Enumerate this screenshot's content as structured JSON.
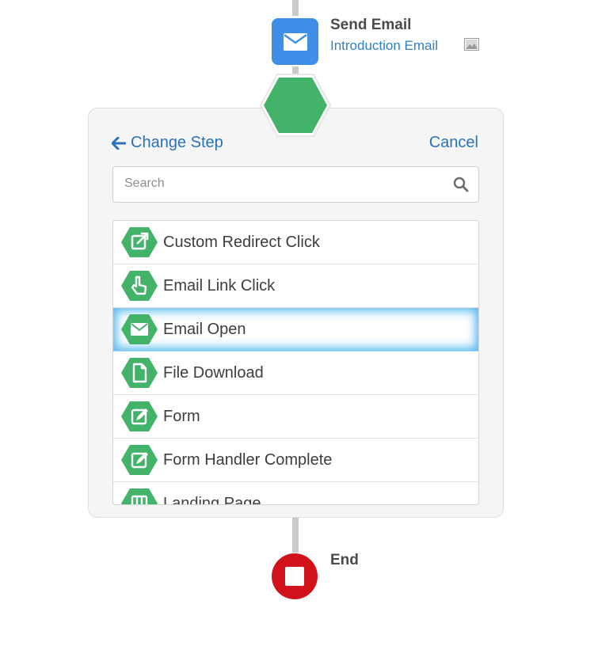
{
  "send_email": {
    "title": "Send Email",
    "subtitle": "Introduction Email",
    "icon": "envelope-icon",
    "subtitle_icon": "image-icon"
  },
  "panel": {
    "change_step_label": "Change Step",
    "cancel_label": "Cancel",
    "search": {
      "placeholder": "Search",
      "value": ""
    },
    "selected_index": 2,
    "items": [
      {
        "label": "Custom Redirect Click",
        "icon": "external-link-icon"
      },
      {
        "label": "Email Link Click",
        "icon": "pointer-hand-icon"
      },
      {
        "label": "Email Open",
        "icon": "envelope-icon"
      },
      {
        "label": "File Download",
        "icon": "file-icon"
      },
      {
        "label": "Form",
        "icon": "edit-form-icon"
      },
      {
        "label": "Form Handler Complete",
        "icon": "edit-form-icon"
      },
      {
        "label": "Landing Page",
        "icon": "landing-page-icon"
      }
    ]
  },
  "end": {
    "title": "End"
  },
  "colors": {
    "step_green": "#43b36a",
    "send_blue": "#3f8fe8",
    "link_blue": "#2a72b8",
    "end_red": "#d2121a",
    "highlight_blue": "#56b8f0"
  }
}
